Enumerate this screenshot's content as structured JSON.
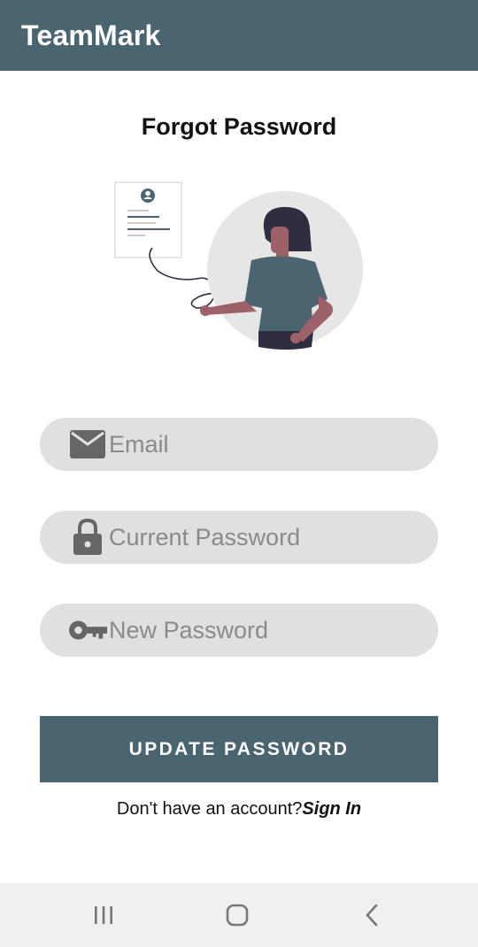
{
  "app_bar": {
    "title": "TeamMark"
  },
  "page": {
    "title": "Forgot Password"
  },
  "form": {
    "email": {
      "placeholder": "Email",
      "value": "",
      "icon": "envelope-icon"
    },
    "current_password": {
      "placeholder": "Current Password",
      "value": "",
      "icon": "lock-icon"
    },
    "new_password": {
      "placeholder": "New Password",
      "value": "",
      "icon": "key-icon"
    },
    "submit_label": "UPDATE PASSWORD"
  },
  "footer": {
    "prompt": "Don't have an account?",
    "link_label": "Sign In"
  },
  "nav_bar": {
    "buttons": [
      "recent-apps-icon",
      "home-icon",
      "back-icon"
    ]
  },
  "colors": {
    "primary": "#4b6570",
    "field_bg": "#e0e0e0",
    "illustration_skin": "#9e616a",
    "illustration_hair": "#2f2e41",
    "illustration_circle": "#e6e6e6"
  }
}
